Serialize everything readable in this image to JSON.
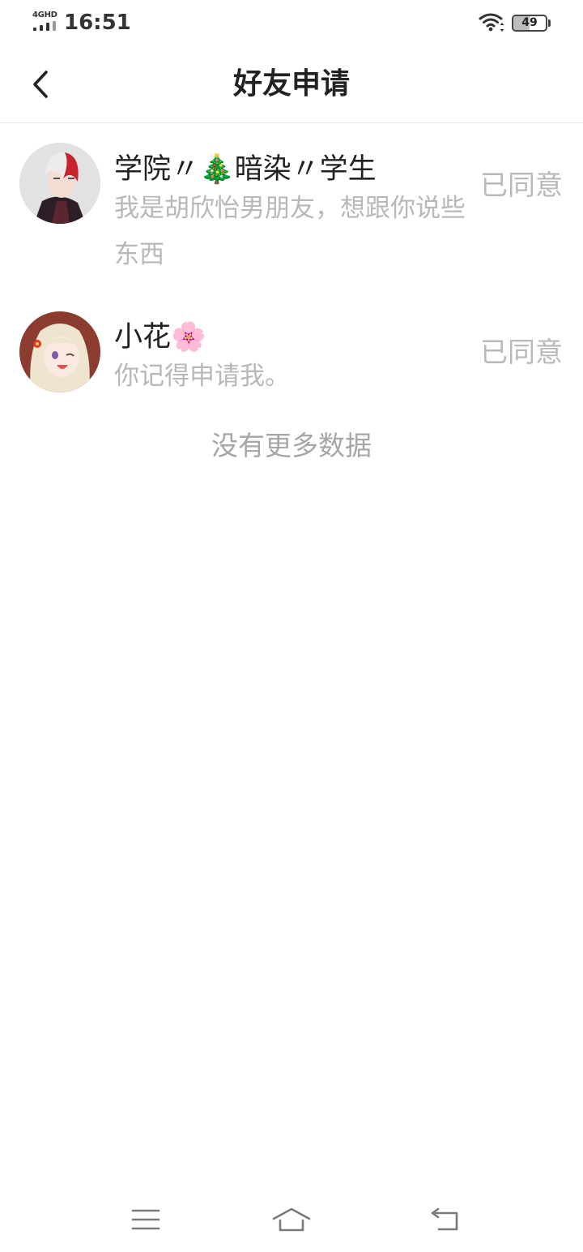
{
  "status_bar": {
    "network_label": "4GHD",
    "time": "16:51",
    "battery_level": "49",
    "battery_fraction": 0.49
  },
  "header": {
    "back_icon": "chevron-left-icon",
    "title": "好友申请"
  },
  "requests": [
    {
      "name": "学院〃🎄暗染〃学生",
      "message": "我是胡欣怡男朋友，想跟你说些东西",
      "status": "已同意"
    },
    {
      "name": "小花🌸",
      "message": "你记得申请我。",
      "status": "已同意"
    }
  ],
  "footer_text": "没有更多数据",
  "nav_bar": {
    "icons": [
      "menu-icon",
      "home-icon",
      "back-icon"
    ]
  },
  "colors": {
    "title_text": "#222222",
    "secondary_text": "#b8b8b8",
    "status_text": "#b9b9b9",
    "divider": "#e6e6e6",
    "background": "#ffffff"
  }
}
